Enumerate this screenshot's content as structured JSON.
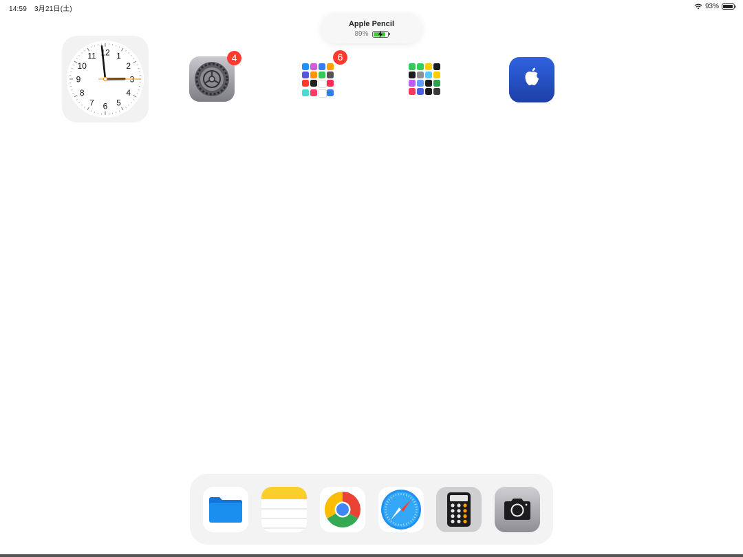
{
  "status_bar": {
    "time": "14:59",
    "date": "3月21日(土)",
    "battery_percent": "93%",
    "battery_level": 0.93,
    "wifi_icon": "wifi-icon",
    "battery_icon": "battery-icon"
  },
  "pencil_hud": {
    "title": "Apple Pencil",
    "battery_percent": "89%",
    "battery_level": 0.89,
    "charging_icon": "bolt-icon",
    "accent_color": "#46c83c"
  },
  "clock_widget": {
    "numbers": [
      "12",
      "1",
      "2",
      "3",
      "4",
      "5",
      "6",
      "7",
      "8",
      "9",
      "10",
      "11"
    ],
    "time_shown": "14:59",
    "second_hand_color": "#ff9500"
  },
  "home_apps": [
    {
      "name": "settings",
      "icon": "gear-icon",
      "badge": "4"
    },
    {
      "name": "folder",
      "icon": "folder-grid-icon",
      "badge": "6"
    },
    {
      "name": "folder-2",
      "icon": "folder-grid-icon",
      "badge": ""
    },
    {
      "name": "apple-support",
      "icon": "apple-logo-icon",
      "badge": ""
    }
  ],
  "dock": {
    "apps": [
      {
        "name": "files",
        "icon": "files-folder-icon"
      },
      {
        "name": "notes",
        "icon": "notes-icon"
      },
      {
        "name": "chrome",
        "icon": "chrome-icon"
      },
      {
        "name": "safari",
        "icon": "safari-compass-icon"
      },
      {
        "name": "calculator",
        "icon": "calculator-icon"
      },
      {
        "name": "camera",
        "icon": "camera-icon"
      }
    ]
  },
  "colors": {
    "badge": "#ff3b30",
    "apple_app_blue": "#2450c8",
    "files_blue": "#1a8ff0"
  }
}
